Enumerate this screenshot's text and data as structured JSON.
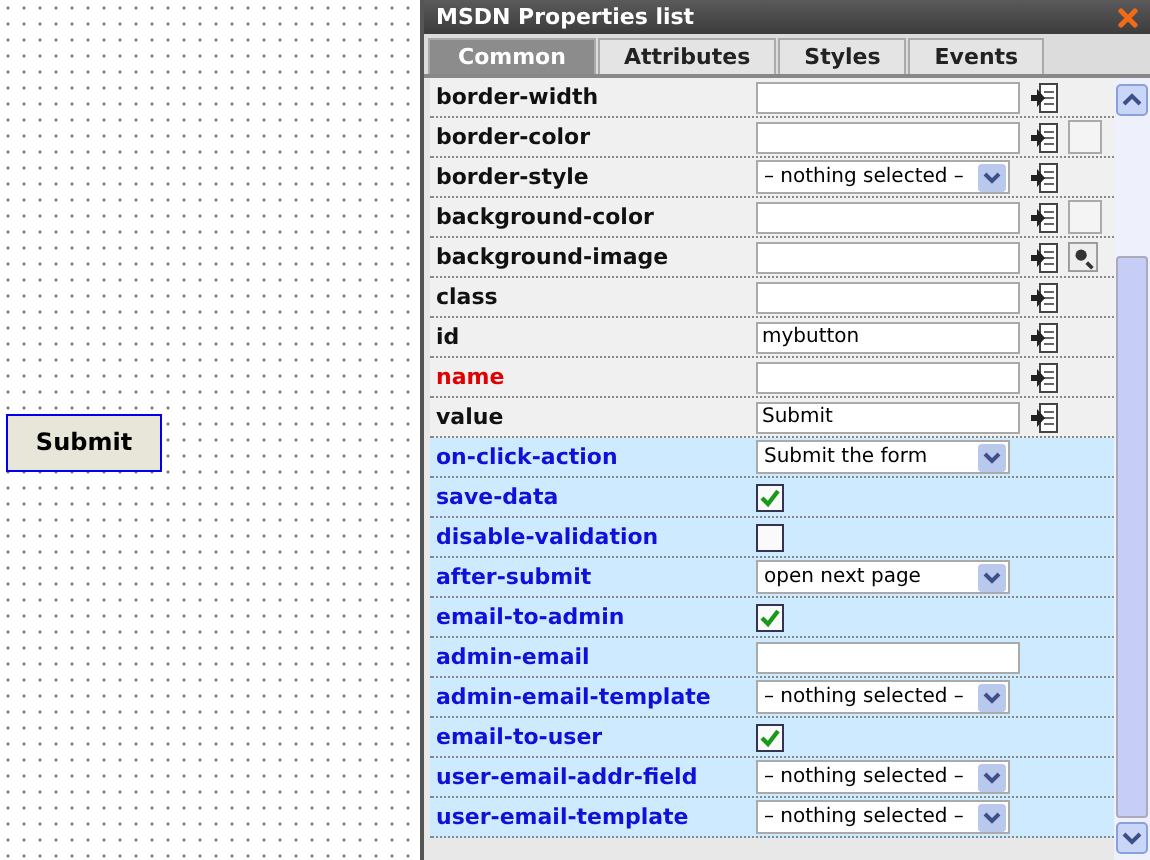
{
  "canvas": {
    "button_label": "Submit"
  },
  "panel": {
    "title": "MSDN Properties list",
    "tabs": [
      {
        "label": "Common",
        "selected": true
      },
      {
        "label": "Attributes",
        "selected": false
      },
      {
        "label": "Styles",
        "selected": false
      },
      {
        "label": "Events",
        "selected": false
      }
    ],
    "rows": [
      {
        "label": "border-width",
        "highlighted": false,
        "required": false,
        "kind": "text",
        "value": ""
      },
      {
        "label": "border-color",
        "highlighted": false,
        "required": false,
        "kind": "text",
        "value": "",
        "extras": [
          {
            "kind": "swatch"
          }
        ]
      },
      {
        "label": "border-style",
        "highlighted": false,
        "required": false,
        "kind": "select",
        "value": "– nothing selected –"
      },
      {
        "label": "background-color",
        "highlighted": false,
        "required": false,
        "kind": "text",
        "value": "",
        "extras": [
          {
            "kind": "swatch"
          }
        ]
      },
      {
        "label": "background-image",
        "highlighted": false,
        "required": false,
        "kind": "text",
        "value": "",
        "extras": [
          {
            "kind": "image"
          }
        ]
      },
      {
        "label": "class",
        "highlighted": false,
        "required": false,
        "kind": "text",
        "value": ""
      },
      {
        "label": "id",
        "highlighted": false,
        "required": false,
        "kind": "text",
        "value": "mybutton"
      },
      {
        "label": "name",
        "highlighted": false,
        "required": true,
        "kind": "text",
        "value": ""
      },
      {
        "label": "value",
        "highlighted": false,
        "required": false,
        "kind": "text",
        "value": "Submit"
      },
      {
        "label": "on-click-action",
        "highlighted": true,
        "required": false,
        "kind": "select",
        "value": "Submit the form"
      },
      {
        "label": "save-data",
        "highlighted": true,
        "required": false,
        "kind": "checkbox",
        "checked": true
      },
      {
        "label": "disable-validation",
        "highlighted": true,
        "required": false,
        "kind": "checkbox",
        "checked": false
      },
      {
        "label": "after-submit",
        "highlighted": true,
        "required": false,
        "kind": "select",
        "value": "open next page"
      },
      {
        "label": "email-to-admin",
        "highlighted": true,
        "required": false,
        "kind": "checkbox",
        "checked": true
      },
      {
        "label": "admin-email",
        "highlighted": true,
        "required": false,
        "kind": "text",
        "value": ""
      },
      {
        "label": "admin-email-template",
        "highlighted": true,
        "required": false,
        "kind": "select",
        "value": "– nothing selected –"
      },
      {
        "label": "email-to-user",
        "highlighted": true,
        "required": false,
        "kind": "checkbox",
        "checked": true
      },
      {
        "label": "user-email-addr-field",
        "highlighted": true,
        "required": false,
        "kind": "select",
        "value": "– nothing selected –"
      },
      {
        "label": "user-email-template",
        "highlighted": true,
        "required": false,
        "kind": "select",
        "value": "– nothing selected –"
      }
    ]
  }
}
